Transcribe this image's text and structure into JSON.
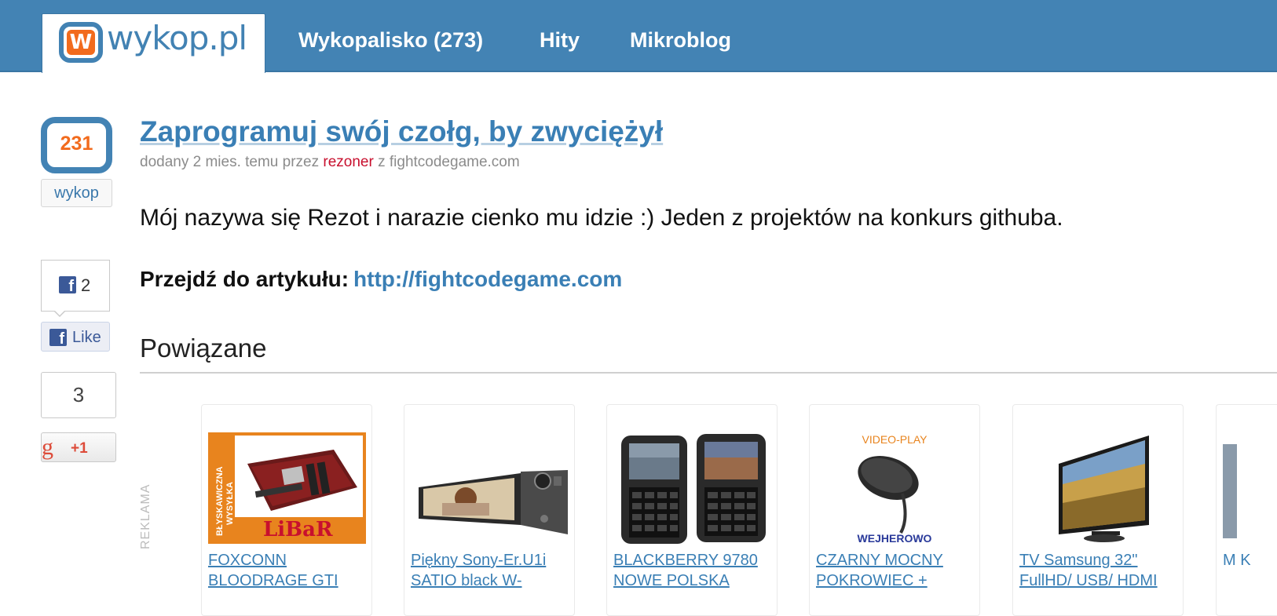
{
  "header": {
    "logo_text": "wykop.pl",
    "nav": [
      {
        "label": "Wykopalisko (273)"
      },
      {
        "label": "Hity"
      },
      {
        "label": "Mikroblog"
      }
    ]
  },
  "vote": {
    "count": "231",
    "button_label": "wykop"
  },
  "social": {
    "facebook_count": "2",
    "facebook_like_label": "Like",
    "gplus_count": "3",
    "gplus_label": "+1"
  },
  "article": {
    "title": "Zaprogramuj swój czołg, by zwyciężył",
    "meta_prefix": "dodany 2 mies. temu przez",
    "author": "rezoner",
    "meta_source_prefix": "z",
    "source": "fightcodegame.com",
    "description": "Mój nazywa się Rezot i narazie cienko mu idzie :) Jeden z projektów na konkurs githuba.",
    "goto_label": "Przejdź do artykułu:",
    "goto_url": "http://fightcodegame.com"
  },
  "related": {
    "heading": "Powiązane",
    "ad_label": "REKLAMA",
    "items": [
      {
        "caption": "FOXCONN BLOODRAGE GTI",
        "thumb_texts": [
          "BŁYSKAWICZNA",
          "WYSYŁKA",
          "LiBaR"
        ]
      },
      {
        "caption": "Piękny Sony-Er.U1i SATIO black W-"
      },
      {
        "caption": "BLACKBERRY 9780 NOWE POLSKA"
      },
      {
        "caption": "CZARNY MOCNY POKROWIEC +",
        "thumb_texts": [
          "VIDEO-PLAY",
          "WEJHEROWO"
        ]
      },
      {
        "caption": "TV Samsung 32\" FullHD/ USB/ HDMI"
      },
      {
        "caption": "M K"
      }
    ]
  },
  "colors": {
    "brand_blue": "#4383b4",
    "accent_orange": "#f26b1d",
    "link_blue": "#3a7fb5",
    "author_red": "#c8102e"
  }
}
